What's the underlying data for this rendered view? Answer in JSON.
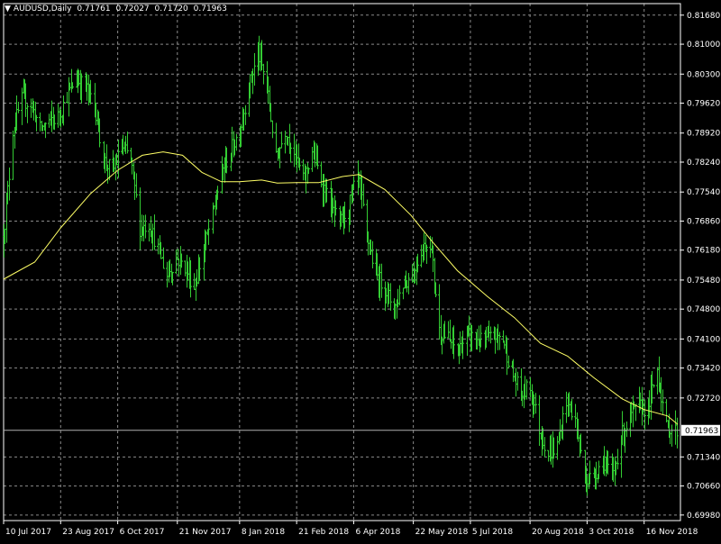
{
  "header": {
    "symbol_timeframe": "AUDUSD,Daily",
    "open": "0.71761",
    "high": "0.72027",
    "low": "0.71720",
    "close": "0.71963"
  },
  "colors": {
    "background": "#000000",
    "grid": "#8a8a8a",
    "axis": "#ffffff",
    "bars": "#33cc33",
    "moving_average": "#ffff66",
    "price_line": "#b0b0b0",
    "price_label_bg": "#ffffff",
    "price_label_text": "#000000"
  },
  "chart_data": {
    "type": "ohlc",
    "symbol": "AUDUSD",
    "timeframe": "Daily",
    "grid": true,
    "ylim": [
      0.6985,
      0.8195
    ],
    "y_ticks": [
      "0.81680",
      "0.81000",
      "0.80300",
      "0.79620",
      "0.78920",
      "0.78240",
      "0.77540",
      "0.76860",
      "0.76180",
      "0.75480",
      "0.74800",
      "0.74100",
      "0.73420",
      "0.72720",
      "0.71963",
      "0.71340",
      "0.70660",
      "0.69980"
    ],
    "x_ticks": [
      "10 Jul 2017",
      "23 Aug 2017",
      "6 Oct 2017",
      "21 Nov 2017",
      "8 Jan 2018",
      "21 Feb 2018",
      "6 Apr 2018",
      "22 May 2018",
      "5 Jul 2018",
      "20 Aug 2018",
      "3 Oct 2018",
      "16 Nov 2018"
    ],
    "current_price": "0.71963",
    "price_path": [
      {
        "date": "2017-07-10",
        "close": 0.765
      },
      {
        "date": "2017-07-17",
        "close": 0.79
      },
      {
        "date": "2017-07-24",
        "close": 0.797
      },
      {
        "date": "2017-07-31",
        "close": 0.796
      },
      {
        "date": "2017-08-07",
        "close": 0.79
      },
      {
        "date": "2017-08-14",
        "close": 0.792
      },
      {
        "date": "2017-08-21",
        "close": 0.793
      },
      {
        "date": "2017-08-28",
        "close": 0.798
      },
      {
        "date": "2017-09-04",
        "close": 0.802
      },
      {
        "date": "2017-09-11",
        "close": 0.8
      },
      {
        "date": "2017-09-18",
        "close": 0.796
      },
      {
        "date": "2017-09-25",
        "close": 0.783
      },
      {
        "date": "2017-10-02",
        "close": 0.78
      },
      {
        "date": "2017-10-09",
        "close": 0.786
      },
      {
        "date": "2017-10-16",
        "close": 0.783
      },
      {
        "date": "2017-10-23",
        "close": 0.767
      },
      {
        "date": "2017-10-30",
        "close": 0.768
      },
      {
        "date": "2017-11-06",
        "close": 0.762
      },
      {
        "date": "2017-11-13",
        "close": 0.756
      },
      {
        "date": "2017-11-20",
        "close": 0.76
      },
      {
        "date": "2017-11-27",
        "close": 0.758
      },
      {
        "date": "2017-12-04",
        "close": 0.753
      },
      {
        "date": "2017-12-11",
        "close": 0.762
      },
      {
        "date": "2017-12-18",
        "close": 0.77
      },
      {
        "date": "2017-12-25",
        "close": 0.78
      },
      {
        "date": "2018-01-01",
        "close": 0.785
      },
      {
        "date": "2018-01-08",
        "close": 0.79
      },
      {
        "date": "2018-01-15",
        "close": 0.8
      },
      {
        "date": "2018-01-22",
        "close": 0.808
      },
      {
        "date": "2018-01-29",
        "close": 0.8
      },
      {
        "date": "2018-02-05",
        "close": 0.783
      },
      {
        "date": "2018-02-12",
        "close": 0.79
      },
      {
        "date": "2018-02-19",
        "close": 0.785
      },
      {
        "date": "2018-02-26",
        "close": 0.778
      },
      {
        "date": "2018-03-05",
        "close": 0.785
      },
      {
        "date": "2018-03-12",
        "close": 0.778
      },
      {
        "date": "2018-03-19",
        "close": 0.772
      },
      {
        "date": "2018-03-26",
        "close": 0.768
      },
      {
        "date": "2018-04-02",
        "close": 0.772
      },
      {
        "date": "2018-04-09",
        "close": 0.779
      },
      {
        "date": "2018-04-16",
        "close": 0.765
      },
      {
        "date": "2018-04-23",
        "close": 0.756
      },
      {
        "date": "2018-04-30",
        "close": 0.753
      },
      {
        "date": "2018-05-07",
        "close": 0.748
      },
      {
        "date": "2018-05-14",
        "close": 0.754
      },
      {
        "date": "2018-05-21",
        "close": 0.756
      },
      {
        "date": "2018-05-28",
        "close": 0.762
      },
      {
        "date": "2018-06-04",
        "close": 0.764
      },
      {
        "date": "2018-06-11",
        "close": 0.743
      },
      {
        "date": "2018-06-18",
        "close": 0.741
      },
      {
        "date": "2018-06-25",
        "close": 0.738
      },
      {
        "date": "2018-07-02",
        "close": 0.742
      },
      {
        "date": "2018-07-09",
        "close": 0.741
      },
      {
        "date": "2018-07-16",
        "close": 0.74
      },
      {
        "date": "2018-07-23",
        "close": 0.742
      },
      {
        "date": "2018-07-30",
        "close": 0.741
      },
      {
        "date": "2018-08-06",
        "close": 0.733
      },
      {
        "date": "2018-08-13",
        "close": 0.728
      },
      {
        "date": "2018-08-20",
        "close": 0.73
      },
      {
        "date": "2018-08-27",
        "close": 0.72
      },
      {
        "date": "2018-09-03",
        "close": 0.714
      },
      {
        "date": "2018-09-10",
        "close": 0.716
      },
      {
        "date": "2018-09-17",
        "close": 0.727
      },
      {
        "date": "2018-09-24",
        "close": 0.722
      },
      {
        "date": "2018-10-01",
        "close": 0.708
      },
      {
        "date": "2018-10-08",
        "close": 0.709
      },
      {
        "date": "2018-10-15",
        "close": 0.713
      },
      {
        "date": "2018-10-22",
        "close": 0.708
      },
      {
        "date": "2018-10-29",
        "close": 0.718
      },
      {
        "date": "2018-11-05",
        "close": 0.723
      },
      {
        "date": "2018-11-12",
        "close": 0.725
      },
      {
        "date": "2018-11-19",
        "close": 0.725
      },
      {
        "date": "2018-11-26",
        "close": 0.734
      },
      {
        "date": "2018-12-03",
        "close": 0.72
      },
      {
        "date": "2018-12-10",
        "close": 0.7196
      }
    ],
    "moving_average": [
      {
        "date": "2017-07-10",
        "value": 0.755
      },
      {
        "date": "2017-08-03",
        "value": 0.759
      },
      {
        "date": "2017-08-23",
        "value": 0.767
      },
      {
        "date": "2017-09-15",
        "value": 0.775
      },
      {
        "date": "2017-10-06",
        "value": 0.7805
      },
      {
        "date": "2017-10-25",
        "value": 0.784
      },
      {
        "date": "2017-11-10",
        "value": 0.7848
      },
      {
        "date": "2017-11-25",
        "value": 0.784
      },
      {
        "date": "2017-12-10",
        "value": 0.78
      },
      {
        "date": "2017-12-25",
        "value": 0.7778
      },
      {
        "date": "2018-01-08",
        "value": 0.7778
      },
      {
        "date": "2018-01-25",
        "value": 0.7782
      },
      {
        "date": "2018-02-06",
        "value": 0.7775
      },
      {
        "date": "2018-02-21",
        "value": 0.7776
      },
      {
        "date": "2018-03-10",
        "value": 0.7776
      },
      {
        "date": "2018-03-28",
        "value": 0.779
      },
      {
        "date": "2018-04-10",
        "value": 0.7795
      },
      {
        "date": "2018-04-30",
        "value": 0.776
      },
      {
        "date": "2018-05-20",
        "value": 0.77
      },
      {
        "date": "2018-06-05",
        "value": 0.764
      },
      {
        "date": "2018-06-25",
        "value": 0.757
      },
      {
        "date": "2018-07-18",
        "value": 0.751
      },
      {
        "date": "2018-08-08",
        "value": 0.746
      },
      {
        "date": "2018-08-28",
        "value": 0.74
      },
      {
        "date": "2018-09-18",
        "value": 0.737
      },
      {
        "date": "2018-10-08",
        "value": 0.732
      },
      {
        "date": "2018-10-30",
        "value": 0.727
      },
      {
        "date": "2018-11-16",
        "value": 0.7245
      },
      {
        "date": "2018-12-04",
        "value": 0.723
      },
      {
        "date": "2018-12-12",
        "value": 0.721
      }
    ]
  }
}
